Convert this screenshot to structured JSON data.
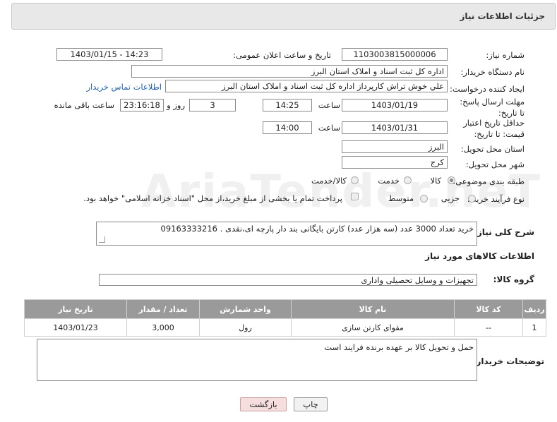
{
  "header": {
    "title": "جزئیات اطلاعات نیاز"
  },
  "fields": {
    "need_number_label": "شماره نیاز:",
    "need_number": "1103003815000006",
    "announce_label": "تاریخ و ساعت اعلان عمومی:",
    "announce_value": "1403/01/15 - 14:23",
    "buyer_org_label": "نام دستگاه خریدار:",
    "buyer_org": "اداره کل ثبت اسناد و املاک استان البرز",
    "requester_label": "ایجاد کننده درخواست:",
    "requester": "علي خوش تراش کارپرداز اداره کل ثبت اسناد و املاک استان البرز",
    "contact_link": "اطلاعات تماس خریدار",
    "deadline_label": "مهلت ارسال پاسخ: تا تاریخ:",
    "deadline_date": "1403/01/19",
    "time_label": "ساعت",
    "deadline_time": "14:25",
    "days_value": "3",
    "days_label": "روز و",
    "remaining_time": "23:16:18",
    "remaining_label": "ساعت باقی مانده",
    "validity_label": "حداقل تاریخ اعتبار قیمت: تا تاریخ:",
    "validity_date": "1403/01/31",
    "validity_time": "14:00",
    "province_label": "استان محل تحویل:",
    "province": "البرز",
    "city_label": "شهر محل تحویل:",
    "city": "کرج",
    "category_label": "طبقه بندی موضوعی:",
    "category_options": [
      "کالا",
      "خدمت",
      "کالا/خدمت"
    ],
    "process_label": "نوع فرآیند خرید :",
    "process_options": [
      "جزیی",
      "متوسط"
    ],
    "payment_note": "پرداخت تمام یا بخشی از مبلغ خرید،از محل \"اسناد خزانه اسلامی\" خواهد بود.",
    "description_label": "شرح کلی نیاز:",
    "description": "خرید تعداد 3000 عدد (سه هزار عدد) کارتن بایگانی  بند دار پارچه ای،نقدی . 09163333216"
  },
  "goods": {
    "section_title": "اطلاعات کالاهای مورد نیاز",
    "group_label": "گروه کالا:",
    "group_value": "تجهیزات و وسایل تحصیلی واداری",
    "columns": [
      "ردیف",
      "کد کالا",
      "نام کالا",
      "واحد شمارش",
      "تعداد / مقدار",
      "تاریخ نیاز"
    ],
    "rows": [
      {
        "row": "1",
        "code": "--",
        "name": "مقوای کارتن سازی",
        "unit": "رول",
        "qty": "3,000",
        "date": "1403/01/23"
      }
    ]
  },
  "buyer_notes": {
    "label": "توضیحات خریدار:",
    "text": "حمل و تحویل کالا بر عهده برنده فرایند است"
  },
  "buttons": {
    "print": "چاپ",
    "back": "بازگشت"
  },
  "watermark": "AriaTender.neT"
}
